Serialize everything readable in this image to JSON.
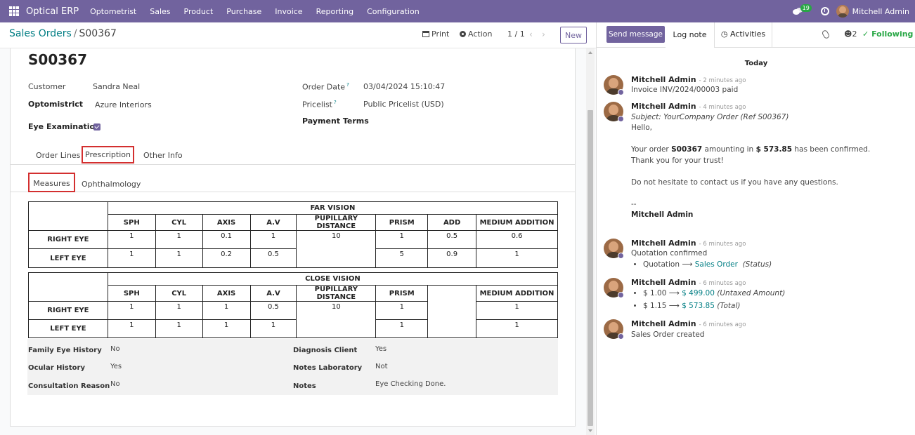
{
  "navbar": {
    "brand": "Optical ERP",
    "menu": [
      "Optometrist",
      "Sales",
      "Product",
      "Purchase",
      "Invoice",
      "Reporting",
      "Configuration"
    ],
    "chat_badge": "19",
    "user": "Mitchell Admin"
  },
  "control_panel": {
    "breadcrumb_parent": "Sales Orders",
    "breadcrumb_sep": "/",
    "breadcrumb_current": "S00367",
    "print": "Print",
    "action": "Action",
    "pager": "1 / 1",
    "new": "New"
  },
  "form": {
    "title": "S00367",
    "customer_label": "Customer",
    "customer": "Sandra Neal",
    "optometrist_label": "Optomistrict",
    "optometrist": "Azure Interiors",
    "eye_exam_label": "Eye Examination",
    "eye_exam_checked": true,
    "order_date_label": "Order Date",
    "order_date": "03/04/2024 15:10:47",
    "pricelist_label": "Pricelist",
    "pricelist": "Public Pricelist (USD)",
    "payment_terms_label": "Payment Terms",
    "tooltip_mark": "?",
    "tabs": [
      "Order Lines",
      "Prescription",
      "Other Info"
    ],
    "active_tab": "Prescription",
    "subtabs": [
      "Measures",
      "Ophthalmology"
    ],
    "active_subtab": "Measures"
  },
  "far_vision": {
    "title": "FAR VISION",
    "headers": [
      "SPH",
      "CYL",
      "AXIS",
      "A.V",
      "PUPILLARY DISTANCE",
      "PRISM",
      "ADD",
      "MEDIUM ADDITION"
    ],
    "right_label": "RIGHT EYE",
    "left_label": "LEFT EYE",
    "right": {
      "sph": "1",
      "cyl": "1",
      "axis": "0.1",
      "av": "1",
      "pd": "10",
      "prism": "1",
      "add": "0.5",
      "medium": "0.6"
    },
    "left": {
      "sph": "1",
      "cyl": "1",
      "axis": "0.2",
      "av": "0.5",
      "prism": "5",
      "add": "0.9",
      "medium": "1"
    }
  },
  "close_vision": {
    "title": "CLOSE VISION",
    "headers": [
      "SPH",
      "CYL",
      "AXIS",
      "A.V",
      "PUPILLARY DISTANCE",
      "PRISM",
      "",
      "MEDIUM ADDITION"
    ],
    "right_label": "RIGHT EYE",
    "left_label": "LEFT EYE",
    "right": {
      "sph": "1",
      "cyl": "1",
      "axis": "1",
      "av": "0.5",
      "pd": "10",
      "prism": "1",
      "medium": "1"
    },
    "left": {
      "sph": "1",
      "cyl": "1",
      "axis": "1",
      "av": "1",
      "prism": "1",
      "medium": "1"
    }
  },
  "summary": {
    "family_history_label": "Family Eye History",
    "family_history": "No",
    "ocular_history_label": "Ocular History",
    "ocular_history": "Yes",
    "consultation_reason_label": "Consultation Reason",
    "consultation_reason": "No",
    "diagnosis_client_label": "Diagnosis Client",
    "diagnosis_client": "Yes",
    "notes_lab_label": "Notes Laboratory",
    "notes_lab": "Not",
    "notes_label": "Notes",
    "notes": "Eye Checking Done."
  },
  "chatter": {
    "send_message": "Send message",
    "log_note": "Log note",
    "activities": "Activities",
    "followers_count": "2",
    "following": "Following",
    "today": "Today",
    "messages": [
      {
        "author": "Mitchell Admin",
        "time": "- 2 minutes ago",
        "line1": "Invoice INV/2024/00003 paid"
      },
      {
        "author": "Mitchell Admin",
        "time": "- 4 minutes ago",
        "subject": "Subject: YourCompany Order (Ref S00367)",
        "hello": "Hello,",
        "confirm_pre": "Your order",
        "confirm_ref": "S00367",
        "confirm_mid": "amounting in",
        "confirm_amount": "$ 573.85",
        "confirm_post": "has been confirmed.",
        "thanks": "Thank you for your trust!",
        "contact": "Do not hesitate to contact us if you have any questions.",
        "sig_dash": "--",
        "signature": "Mitchell Admin"
      },
      {
        "author": "Mitchell Admin",
        "time": "- 6 minutes ago",
        "line1": "Quotation confirmed",
        "old": "Quotation",
        "arrow": "⟶",
        "new": "Sales Order",
        "field": "(Status)"
      },
      {
        "author": "Mitchell Admin",
        "time": "- 6 minutes ago",
        "old1": "$ 1.00",
        "new1": "$ 499.00",
        "field1": "(Untaxed Amount)",
        "old2": "$ 1.15",
        "new2": "$ 573.85",
        "field2": "(Total)"
      },
      {
        "author": "Mitchell Admin",
        "time": "- 6 minutes ago",
        "line1": "Sales Order created"
      }
    ]
  },
  "colors": {
    "brand": "#71639e",
    "link": "#017e84",
    "success": "#28a745",
    "highlight_box": "#d32f2f"
  },
  "icons": [
    "apps-grid-icon",
    "chat-icon",
    "clock-icon",
    "printer-icon",
    "gear-icon",
    "chevron-left-icon",
    "chevron-right-icon",
    "paperclip-icon",
    "user-icon",
    "check-icon"
  ]
}
